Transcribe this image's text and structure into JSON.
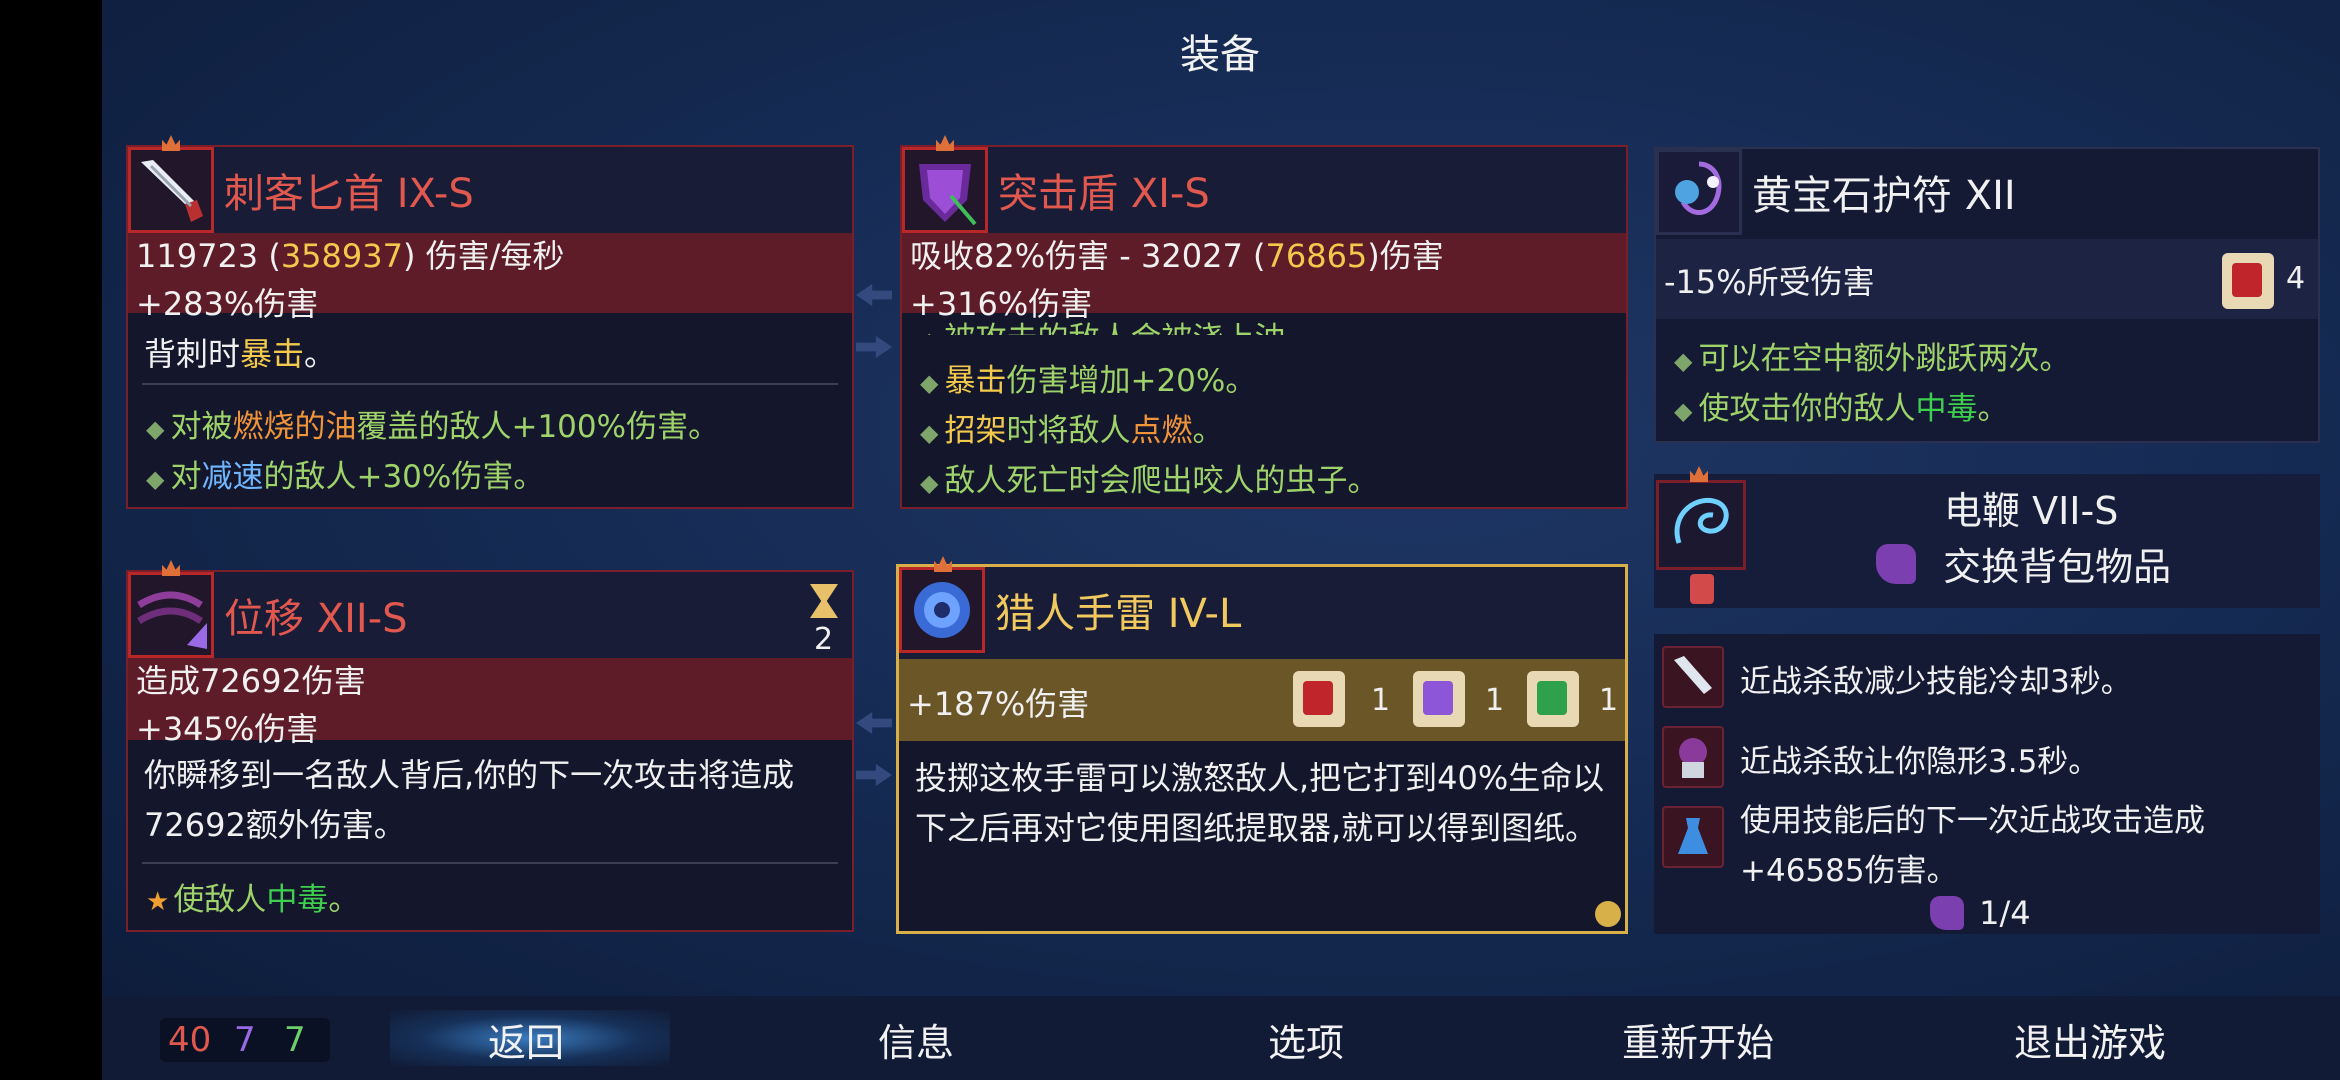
{
  "header": {
    "title": "装备"
  },
  "weapon1": {
    "name": "刺客匕首 IX-S",
    "dps_base": "119723 (",
    "dps_crit": "358937",
    "dps_suffix": ") 伤害/每秒",
    "bonus": "+283%伤害",
    "desc_prefix": "背刺时",
    "desc_keyword": "暴击",
    "desc_suffix": "。",
    "mod1": {
      "p1": "对被",
      "p2": "燃烧的油",
      "p3": "覆盖的敌人+100%伤害。"
    },
    "mod2": {
      "p1": "对",
      "p2": "减速",
      "p3": "的敌人+30%伤害。"
    }
  },
  "shield": {
    "name": "突击盾 XI-S",
    "block_prefix": "吸收82%伤害 - 32027 (",
    "block_crit": "76865",
    "block_suffix": ")伤害",
    "bonus": "+316%伤害",
    "mod0": "被攻击的敌人会被浇上油。",
    "mod1": {
      "p1": "暴击",
      "p2": "伤害增加+20%。"
    },
    "mod2": {
      "p1": "招架",
      "p2": "时将敌人",
      "p3": "点燃",
      "p4": "。"
    },
    "mod3": "敌人死亡时会爬出咬人的虫子。"
  },
  "amulet": {
    "name": "黄宝石护符 XII",
    "stat": "-15%所受伤害",
    "scroll_count": "4",
    "mod1": "可以在空中额外跳跃两次。",
    "mod2": {
      "p1": "使攻击你的敌人",
      "p2": "中毒",
      "p3": "。"
    }
  },
  "skill1": {
    "name": "位移 XII-S",
    "cooldown": "2",
    "damage": "造成72692伤害",
    "bonus": "+345%伤害",
    "desc": "你瞬移到一名敌人背后,你的下一次攻击将造成72692额外伤害。",
    "mod1": {
      "p1": "使敌人",
      "p2": "中毒",
      "p3": "。"
    }
  },
  "skill2": {
    "name": "猎人手雷 IV-L",
    "bonus": "+187%伤害",
    "scroll_counts": [
      "1",
      "1",
      "1"
    ],
    "desc": "投掷这枚手雷可以激怒敌人,把它打到40%生命以下之后再对它使用图纸提取器,就可以得到图纸。"
  },
  "backpack": {
    "name": "电鞭 VII-S",
    "swap_label": "交换背包物品"
  },
  "perks": {
    "items": [
      "近战杀敌减少技能冷却3秒。",
      "近战杀敌让你隐形3.5秒。",
      "使用技能后的下一次近战攻击造成+46585伤害。"
    ],
    "slots": "1/4"
  },
  "footer": {
    "scroll_red": "40",
    "scroll_purple": "7",
    "scroll_green": "7",
    "back": "返回",
    "info": "信息",
    "options": "选项",
    "restart": "重新开始",
    "quit": "退出游戏"
  },
  "colors": {
    "brutality": "#e0584e",
    "tactics": "#9a6ae6",
    "survival": "#6fcf6a",
    "legendary_gold": "#d8b04a"
  }
}
